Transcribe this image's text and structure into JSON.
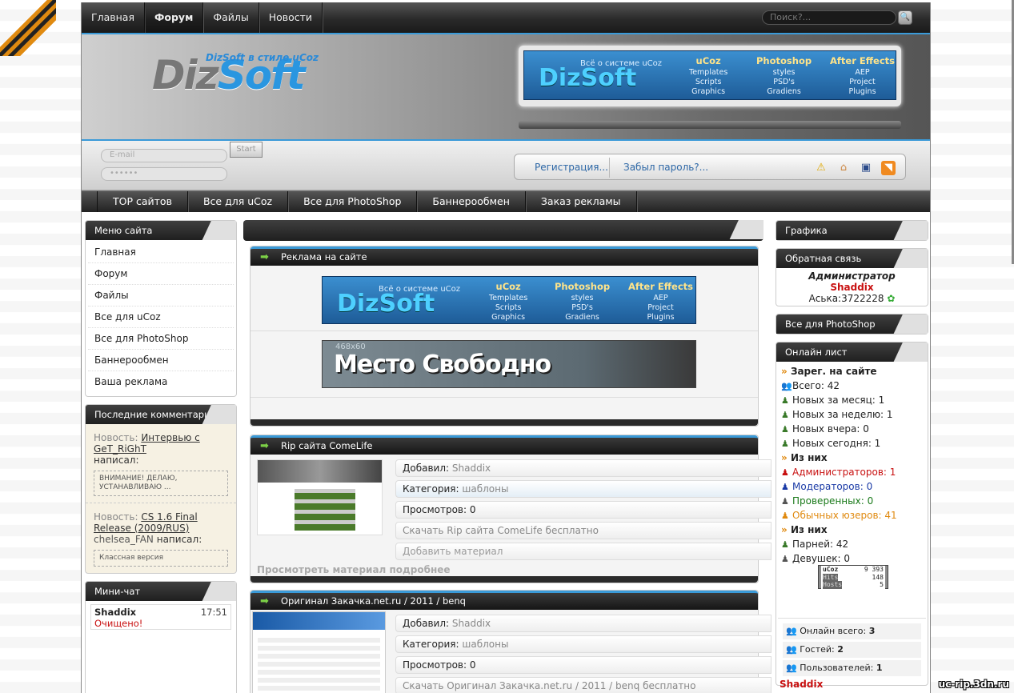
{
  "topnav": {
    "items": [
      "Главная",
      "Форум",
      "Файлы",
      "Новости"
    ],
    "active": "Форум",
    "search_placeholder": "Поиск?...",
    "search_button": "🔍"
  },
  "header": {
    "logo_a": "Diz",
    "logo_b": "Soft",
    "tagline": "DizSoft в стиле uCoz"
  },
  "banner": {
    "logo": "DizSoft",
    "slogan": "Всё о системе uCoz",
    "cols": [
      {
        "title": "uCoz",
        "items": [
          "Templates",
          "Scripts",
          "Graphics"
        ]
      },
      {
        "title": "Photoshop",
        "items": [
          "styles",
          "PSD's",
          "Gradiens"
        ]
      },
      {
        "title": "After Effects",
        "items": [
          "AEP",
          "Project",
          "Plugins"
        ]
      }
    ]
  },
  "login": {
    "email_placeholder": "E-mail",
    "password_placeholder": "••••••",
    "start": "Start",
    "register": "Регистрация...",
    "forgot": "Забыл пароль?..."
  },
  "menu2": [
    "TOP сайтов",
    "Все для uCoz",
    "Все для PhotoShop",
    "Баннерообмен",
    "Заказ рекламы"
  ],
  "left": {
    "menu_title": "Меню сайта",
    "menu": [
      "Главная",
      "Форум",
      "Файлы",
      "Все для uCoz",
      "Все для PhotoShop",
      "Баннерообмен",
      "Ваша реклама"
    ],
    "comments_title": "Последние комментарии",
    "comments": [
      {
        "label": "Новость:",
        "link": "Интервью с GeT_RiGhT",
        "author": "",
        "action": "написал:",
        "quote": "ВНИМАНИЕ! ДЕЛАЮ, УСТАНАВЛИВАЮ ..."
      },
      {
        "label": "Новость:",
        "link": "CS 1.6 Final Release (2009/RUS)",
        "author": "chelsea_FAN",
        "action": "написал:",
        "quote": "Классная версия"
      }
    ],
    "chat_title": "Мини-чат",
    "chat": {
      "user": "Shaddix",
      "time": "17:51",
      "message": "Очищено!"
    }
  },
  "center": {
    "ad_title": "Реклама на сайте",
    "free_banner": "Место Свободно",
    "free_size": "468x60",
    "posts": [
      {
        "title": "Rip сайта ComeLife",
        "added_label": "Добавил:",
        "added": "Shaddix",
        "cat_label": "Категория:",
        "cat": "шаблоны",
        "views_label": "Просмотров:",
        "views": "0",
        "download": "Скачать Rip сайта ComeLife бесплатно",
        "add": "Добавить материал",
        "more": "Просмотреть материал подробнее"
      },
      {
        "title": "Оригинал Закачка.net.ru / 2011 / benq",
        "added_label": "Добавил:",
        "added": "Shaddix",
        "cat_label": "Категория:",
        "cat": "шаблоны",
        "views_label": "Просмотров:",
        "views": "0",
        "download": "Скачать Оригинал Закачка.net.ru / 2011 / benq бесплатно"
      }
    ]
  },
  "right": {
    "graphics_title": "Графика",
    "feedback_title": "Обратная связь",
    "admin_role": "Администратор",
    "admin_name": "Shaddix",
    "icq": "Аська:3722228",
    "ps_title": "Все для PhotoShop",
    "online_title": "Онлайн лист",
    "reg_head": "Зарег. на сайте",
    "reg": [
      "Всего: 42",
      "Новых за месяц: 1",
      "Новых за неделю: 1",
      "Новых вчера: 0",
      "Новых сегодня: 1"
    ],
    "of_head": "Из них",
    "roles": [
      {
        "t": "Администраторов: 1",
        "c": "#c81010"
      },
      {
        "t": "Модераторов: 0",
        "c": "#1a3aa6"
      },
      {
        "t": "Проверенных: 0",
        "c": "#1a7a1a"
      },
      {
        "t": "Обычных юзеров: 41",
        "c": "#e08a10"
      }
    ],
    "of_head2": "Из них",
    "gender": [
      "Парней: 42",
      "Девушек: 0"
    ],
    "counter": {
      "name": "uCoz",
      "v1": "9 393",
      "l2": "Hits",
      "v2": "148",
      "l3": "Hosts",
      "v3": "5"
    },
    "totals": [
      {
        "l": "Онлайн всего:",
        "v": "3"
      },
      {
        "l": "Гостей:",
        "v": "2"
      },
      {
        "l": "Пользователей:",
        "v": "1"
      }
    ],
    "user_online": "Shaddix"
  },
  "watermark": "uc-rip.3dn.ru"
}
